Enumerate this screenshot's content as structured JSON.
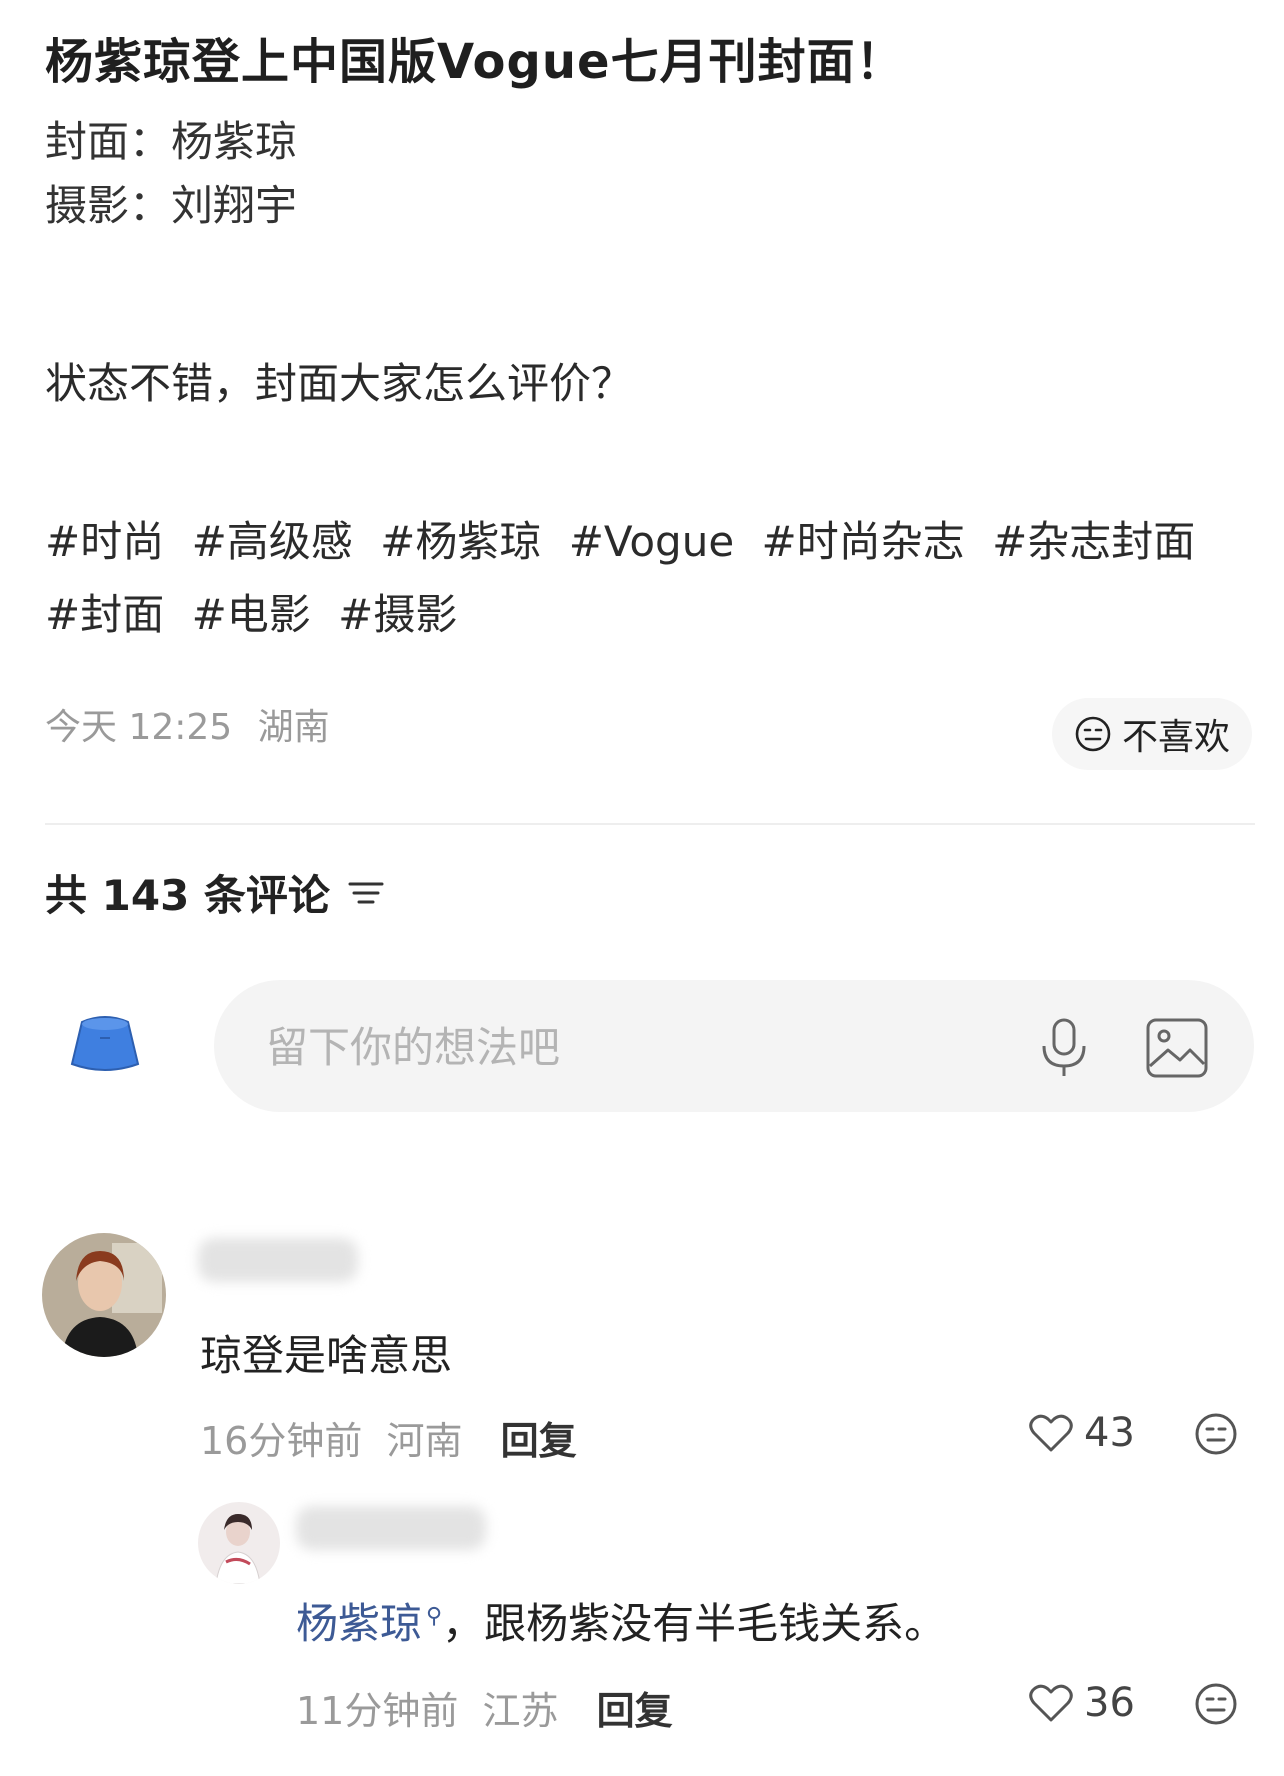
{
  "post": {
    "title": "杨紫琼登上中国版Vogue七月刊封面！",
    "cover_line": "封面：杨紫琼",
    "photo_line": "摄影：刘翔宇",
    "body": "状态不错，封面大家怎么评价？",
    "tags": [
      "#时尚",
      "#高级感",
      "#杨紫琼",
      "#Vogue",
      "#时尚杂志",
      "#杂志封面",
      "#封面",
      "#电影",
      "#摄影"
    ],
    "time": "今天 12:25",
    "location": "湖南",
    "dislike_label": "不喜欢"
  },
  "comments_header": {
    "count_label": "共 143 条评论",
    "sort_icon": "sort-lines-icon"
  },
  "comment_input": {
    "placeholder": "留下你的想法吧",
    "mic_icon": "microphone-icon",
    "image_icon": "image-icon"
  },
  "comments": [
    {
      "text": "琼登是啥意思",
      "time": "16分钟前",
      "location": "河南",
      "reply_label": "回复",
      "likes": "43"
    },
    {
      "mention": "杨紫琼",
      "text": "，跟杨紫没有半毛钱关系。",
      "time": "11分钟前",
      "location": "江苏",
      "reply_label": "回复",
      "likes": "36"
    }
  ],
  "colors": {
    "mention": "#3d5a95",
    "muted": "#9a9a9a",
    "avatar_hat": "#3f7fe0"
  }
}
